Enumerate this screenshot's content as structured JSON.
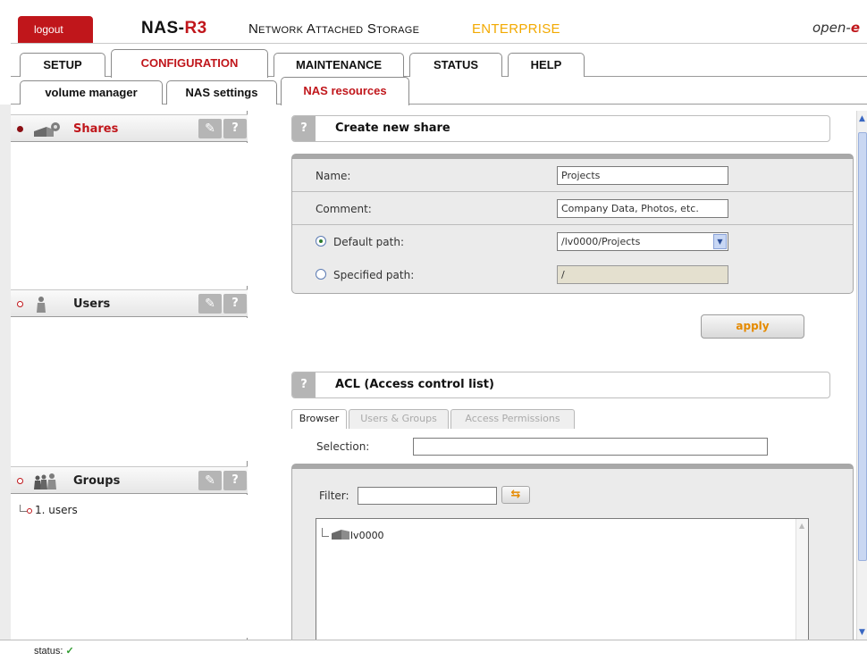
{
  "header": {
    "logout_label": "logout",
    "brand_prefix": "NAS-",
    "brand_suffix": "R3",
    "title": "Network Attached Storage",
    "edition": "ENTERPRISE",
    "vendor_prefix": "open-",
    "vendor_suffix": "e"
  },
  "main_tabs": [
    {
      "label": "SETUP",
      "active": false
    },
    {
      "label": "CONFIGURATION",
      "active": true
    },
    {
      "label": "MAINTENANCE",
      "active": false
    },
    {
      "label": "STATUS",
      "active": false
    },
    {
      "label": "HELP",
      "active": false
    }
  ],
  "sub_tabs": [
    {
      "label": "volume manager",
      "active": false
    },
    {
      "label": "NAS settings",
      "active": false
    },
    {
      "label": "NAS resources",
      "active": true
    }
  ],
  "left_sections": {
    "shares": {
      "title": "Shares",
      "icon": "shares-icon",
      "tool": "wrench-icon",
      "help": "?"
    },
    "users": {
      "title": "Users",
      "icon": "user-icon",
      "tool": "wrench-icon",
      "help": "?"
    },
    "groups": {
      "title": "Groups",
      "icon": "groups-icon",
      "tool": "wrench-icon",
      "help": "?",
      "items": [
        "1. users"
      ]
    }
  },
  "create_share": {
    "help": "?",
    "title": "Create new share",
    "name_label": "Name:",
    "name_value": "Projects",
    "comment_label": "Comment:",
    "comment_value": "Company Data, Photos, etc.",
    "default_path_label": "Default path:",
    "default_path_value": "/lv0000/Projects",
    "default_path_selected": true,
    "specified_path_label": "Specified path:",
    "specified_path_value": "/",
    "apply_label": "apply"
  },
  "acl": {
    "help": "?",
    "title": "ACL (Access control list)",
    "tabs": [
      "Browser",
      "Users & Groups",
      "Access Permissions"
    ],
    "active_tab": "Browser",
    "selection_label": "Selection:",
    "selection_value": "",
    "filter_label": "Filter:",
    "filter_value": "",
    "tree": [
      "lv0000"
    ]
  },
  "status": {
    "label": "status:",
    "ok_mark": "✓"
  },
  "colors": {
    "brand_red": "#c0161b",
    "enterprise_yellow": "#f2a900",
    "apply_orange": "#e58a00"
  }
}
